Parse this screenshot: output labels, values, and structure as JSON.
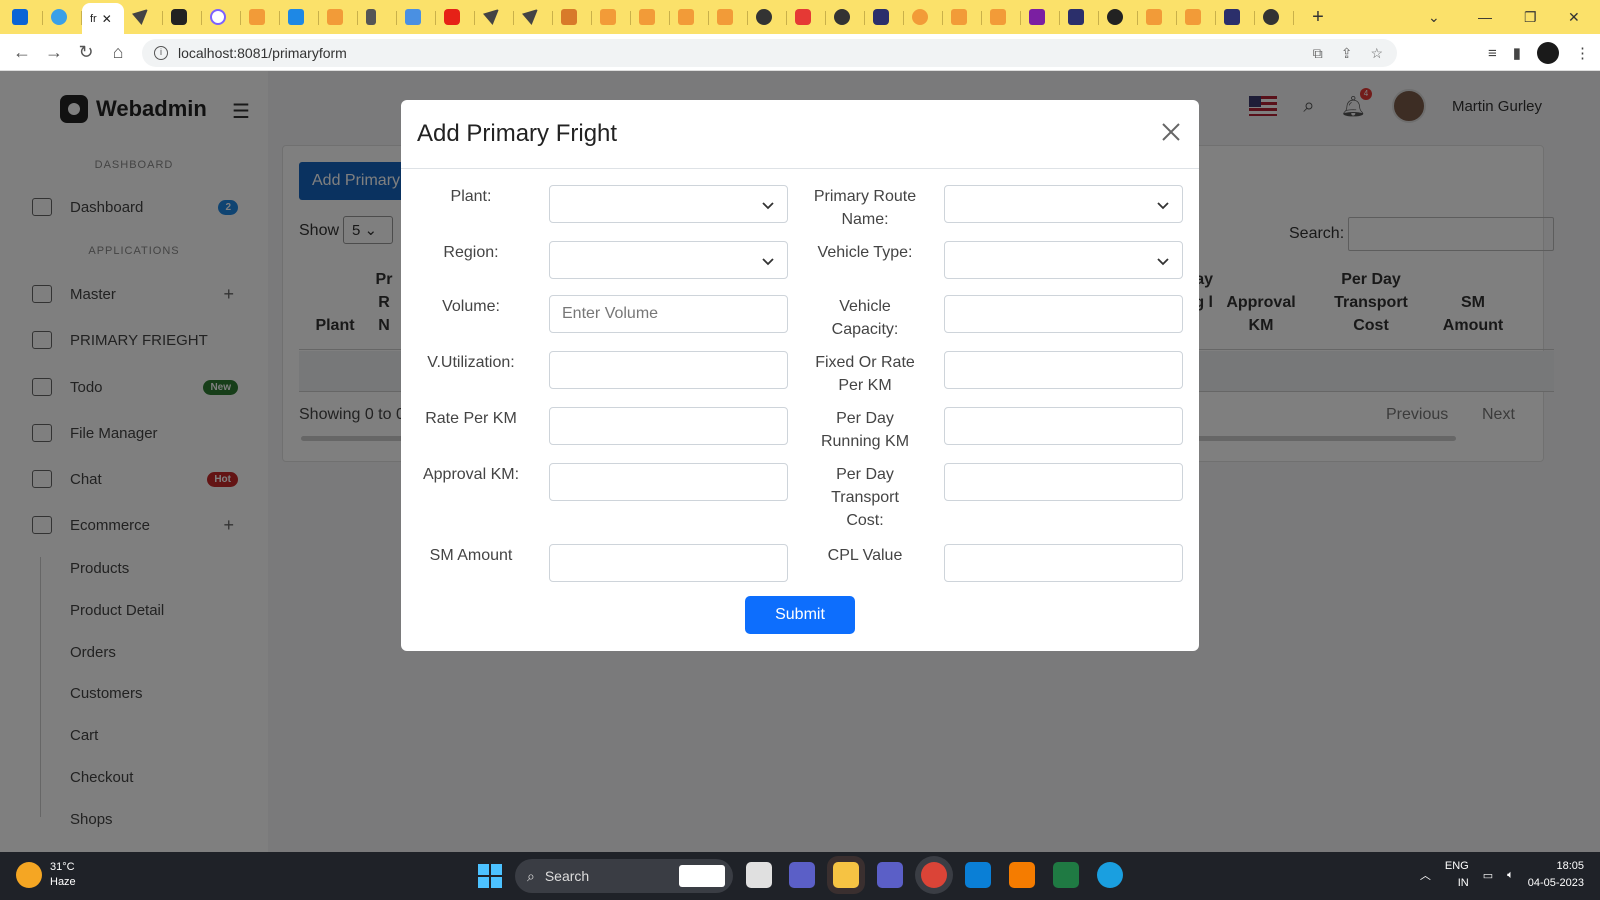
{
  "browser": {
    "active_tab_label": "fr",
    "url": "localhost:8081/primaryform"
  },
  "app": {
    "brand": "Webadmin",
    "sidebar": {
      "section_dashboard": "DASHBOARD",
      "section_applications": "APPLICATIONS",
      "items": [
        {
          "label": "Dashboard",
          "badge": "2"
        },
        {
          "label": "Master"
        },
        {
          "label": "PRIMARY FRIEGHT"
        },
        {
          "label": "Todo",
          "badge": "New"
        },
        {
          "label": "File Manager"
        },
        {
          "label": "Chat",
          "badge": "Hot"
        },
        {
          "label": "Ecommerce"
        }
      ],
      "subitems": [
        "Products",
        "Product Detail",
        "Orders",
        "Customers",
        "Cart",
        "Checkout",
        "Shops"
      ]
    },
    "topbar": {
      "user_name": "Martin Gurley",
      "notifications": "4"
    },
    "list": {
      "add_button": "Add Primary",
      "show_label": "Show",
      "show_value": "5",
      "search_label": "Search:",
      "columns": [
        "Plant",
        "Pr R N",
        "ay ing l",
        "Approval KM",
        "Per Day Transport Cost",
        "SM Amount"
      ],
      "showing": "Showing 0 to 0",
      "previous": "Previous",
      "next": "Next"
    }
  },
  "modal": {
    "title": "Add Primary Fright",
    "fields": {
      "plant": "Plant:",
      "primary_route_name": "Primary Route Name:",
      "region": "Region:",
      "vehicle_type": "Vehicle Type:",
      "volume": "Volume:",
      "volume_placeholder": "Enter Volume",
      "vehicle_capacity": "Vehicle Capacity:",
      "v_utilization": "V.Utilization:",
      "fixed_or_rate": "Fixed Or Rate Per KM",
      "rate_per_km": "Rate Per KM",
      "per_day_running_km": "Per Day Running KM",
      "approval_km": "Approval KM:",
      "per_day_transport_cost": "Per Day Transport Cost:",
      "sm_amount": "SM Amount",
      "cpl_value": "CPL Value"
    },
    "submit": "Submit"
  },
  "taskbar": {
    "temperature": "31°C",
    "weather": "Haze",
    "search": "Search",
    "lang": "ENG",
    "region": "IN",
    "time": "18:05",
    "date": "04-05-2023"
  },
  "colors": {
    "tab_strip": "#fbe16a",
    "primary": "#0d6efd",
    "add_button": "#1565c0",
    "badge_blue": "#1e88e5",
    "badge_green": "#2e7d32",
    "badge_red": "#c62828"
  }
}
